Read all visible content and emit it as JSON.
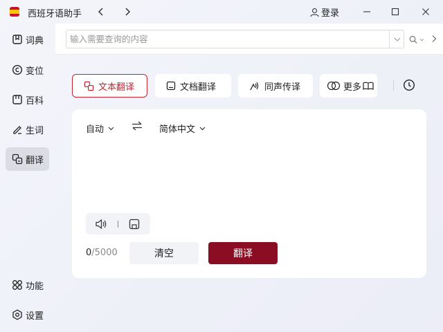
{
  "app": {
    "title": "西班牙语助手",
    "login_label": "登录"
  },
  "sidebar": {
    "items": [
      {
        "label": "词典"
      },
      {
        "label": "变位"
      },
      {
        "label": "百科"
      },
      {
        "label": "生词"
      },
      {
        "label": "翻译"
      }
    ],
    "bottom": [
      {
        "label": "功能"
      },
      {
        "label": "设置"
      }
    ]
  },
  "search": {
    "placeholder": "输入需要查询的内容",
    "value": ""
  },
  "tabs": [
    {
      "label": "文本翻译"
    },
    {
      "label": "文档翻译"
    },
    {
      "label": "同声传译"
    },
    {
      "label": "更多"
    }
  ],
  "translator": {
    "source_lang": "自动",
    "target_lang": "简体中文",
    "input_text": "",
    "count": "0",
    "max": "/5000",
    "clear_label": "清空",
    "translate_label": "翻译"
  },
  "colors": {
    "accent": "#c7202f",
    "primary_button": "#8b0d23",
    "active_nav_bg": "#dcdde4"
  }
}
